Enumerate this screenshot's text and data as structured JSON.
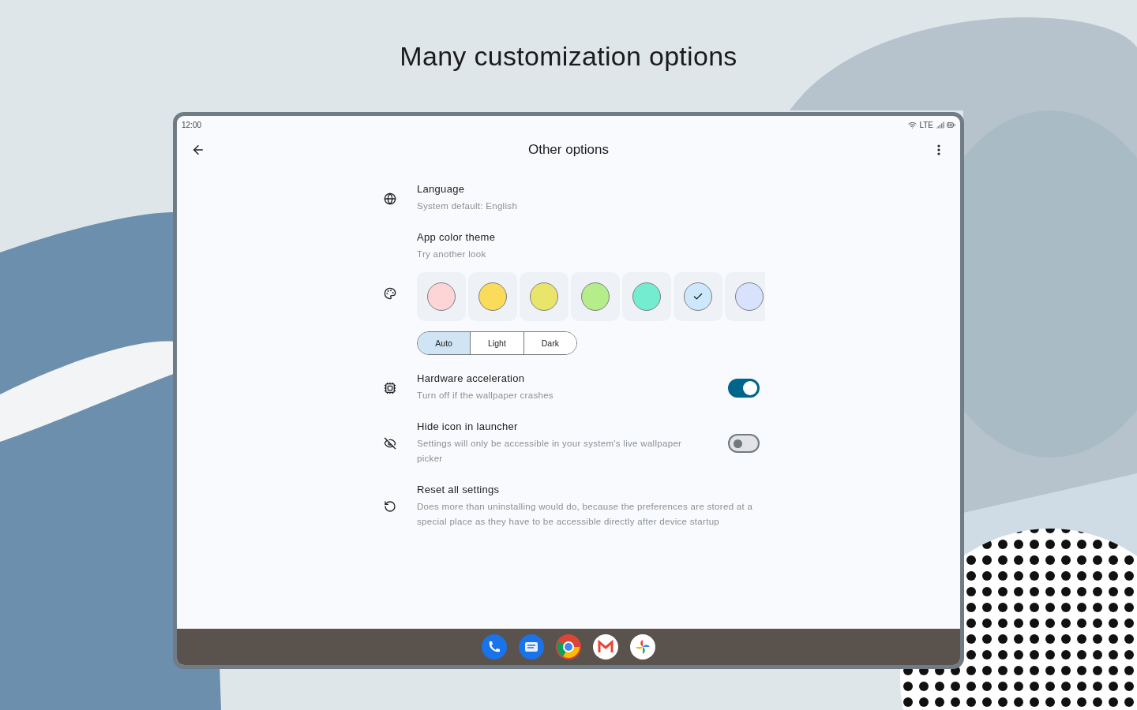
{
  "headline": "Many customization options",
  "status_bar": {
    "time": "12:00",
    "network": "LTE"
  },
  "app_bar": {
    "title": "Other options"
  },
  "settings": [
    {
      "kind": "plain",
      "title": "Language",
      "subtitle": "System default: English"
    },
    {
      "kind": "theme",
      "title": "App color theme",
      "subtitle": "Try another look",
      "swatches": [
        {
          "color": "#fdd5d6",
          "selected": false
        },
        {
          "color": "#fbdc5a",
          "selected": false
        },
        {
          "color": "#e9e56b",
          "selected": false
        },
        {
          "color": "#b4ed8a",
          "selected": false
        },
        {
          "color": "#74ecd0",
          "selected": false
        },
        {
          "color": "#cde8fc",
          "selected": true
        },
        {
          "color": "#d9e2fc",
          "selected": false
        }
      ],
      "modes": [
        {
          "label": "Auto",
          "selected": true
        },
        {
          "label": "Light",
          "selected": false
        },
        {
          "label": "Dark",
          "selected": false
        }
      ]
    },
    {
      "kind": "switch",
      "title": "Hardware acceleration",
      "subtitle": "Turn off if the wallpaper crashes",
      "on": true
    },
    {
      "kind": "switch",
      "title": "Hide icon in launcher",
      "subtitle": "Settings will only be accessible in your system's live wallpaper picker",
      "on": false
    },
    {
      "kind": "plain",
      "title": "Reset all settings",
      "subtitle": "Does more than uninstalling would do, because the preferences are stored at a special place as they have to be accessible directly after device startup"
    }
  ]
}
